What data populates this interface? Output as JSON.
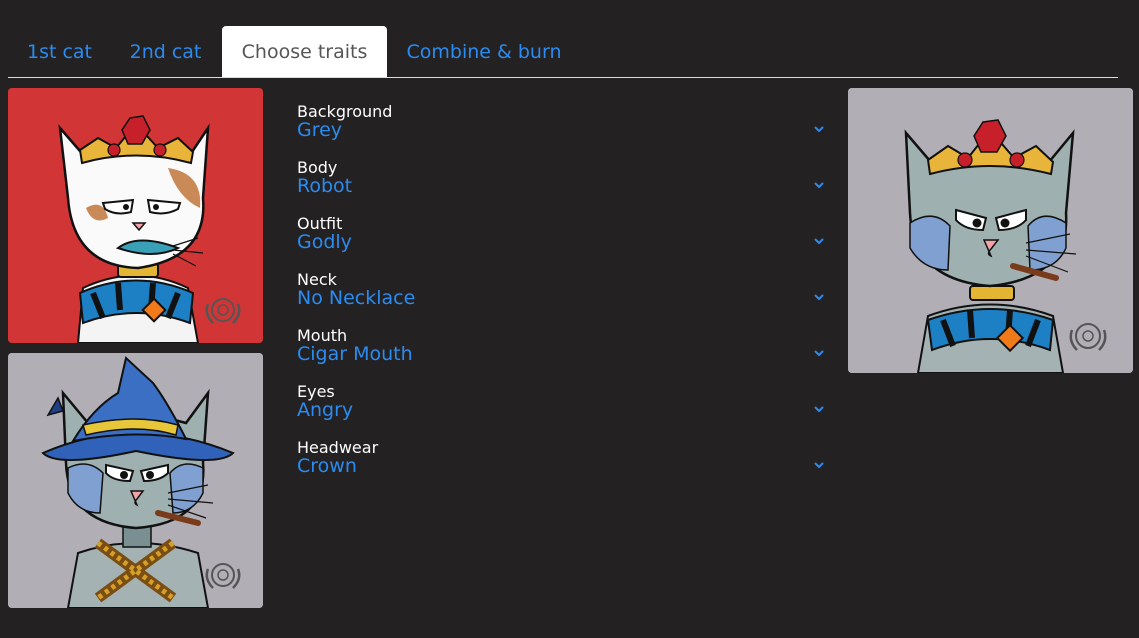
{
  "tabs": [
    {
      "label": "1st cat",
      "active": false
    },
    {
      "label": "2nd cat",
      "active": false
    },
    {
      "label": "Choose traits",
      "active": true
    },
    {
      "label": "Combine & burn",
      "active": false
    }
  ],
  "cards": {
    "first_cat": {
      "background": "#d23535",
      "fur": "#ffffff",
      "headwear": "crown"
    },
    "second_cat": {
      "background": "#b1aeb6",
      "fur": "#9fb0b0",
      "headwear": "wizard-hat"
    },
    "result_cat": {
      "background": "#b1aeb6",
      "fur": "#9fb0b0",
      "headwear": "crown"
    }
  },
  "traits": [
    {
      "label": "Background",
      "value": "Grey"
    },
    {
      "label": "Body",
      "value": "Robot"
    },
    {
      "label": "Outfit",
      "value": "Godly"
    },
    {
      "label": "Neck",
      "value": "No Necklace"
    },
    {
      "label": "Mouth",
      "value": "Cigar Mouth"
    },
    {
      "label": "Eyes",
      "value": "Angry"
    },
    {
      "label": "Headwear",
      "value": "Crown"
    }
  ],
  "icons": {
    "dropdown": "chevron-down-icon",
    "watermark": "laurel-seal-icon"
  },
  "colors": {
    "page_bg": "#242122",
    "accent": "#2a8cf0",
    "active_tab_bg": "#ffffff"
  }
}
